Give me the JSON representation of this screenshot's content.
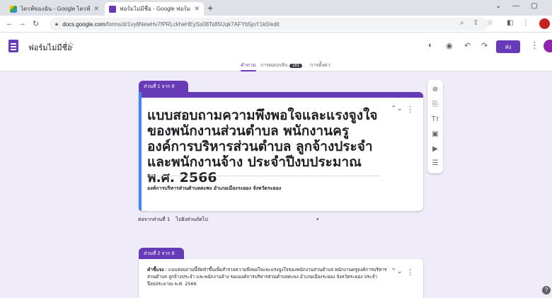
{
  "browser": {
    "tabs": [
      {
        "title": "ไดรฟ์ของฉัน - Google ไดรฟ์"
      },
      {
        "title": "ฟอร์มไม่มีชื่อ - Google ฟอร์ม"
      }
    ],
    "url_host": "docs.google.com",
    "url_path": "/forms/d/1vy8NewHv7fPRLckheHEySs08Ts85Uqk7AFYb5joY1k0/edit",
    "icons": [
      "back-icon",
      "forward-icon",
      "reload-icon",
      "lock-icon",
      "zoom-icon",
      "share-icon",
      "bookmark-star-icon",
      "sidepanel-icon",
      "profile-icon"
    ]
  },
  "form_header": {
    "title": "ฟอร์มไม่มีชื่อ",
    "send_label": "ส่ง",
    "tabs": [
      "คำถาม",
      "การตอบกลับ",
      "การตั้งค่า"
    ],
    "response_count": "181"
  },
  "section1": {
    "tag": "ส่วนที่ 1 จาก 8",
    "title": "แบบสอบถามความพึงพอใจและแรงจูงใจของพนักงานส่วนตำบล พนักงานครูองค์การบริหารส่วนตำบล ลูกจ้างประจำ และพนักงานจ้าง ประจำปีงบประมาณ พ.ศ. 2566",
    "subtitle": "องค์การบริหารส่วนตำบลตะพง อำเภอเมืองระยอง จังหวัดระยอง"
  },
  "after_section": {
    "label": "ต่อจากส่วนที่ 1",
    "value": "ไปยังส่วนถัดไป"
  },
  "section2": {
    "tag": "ส่วนที่ 2 จาก 8",
    "desc_label": "คำชี้แจง",
    "desc": ": แบบสอบถามนี้จัดทำขึ้นเพื่อสำรวจความพึงพอใจและแรงจูงใจของพนักงานส่วนตำบล พนักงานครูองค์การบริหารส่วนตำบล ลูกจ้างประจำ และพนักงานจ้าง ขององค์การบริหารส่วนตำบลตะพง อำเภอเมืองระยอง จังหวัดระยอง ประจำปีงบประมาณ พ.ศ. 2566"
  },
  "toolbar": [
    "add-question-icon",
    "import-questions-icon",
    "add-title-icon",
    "add-image-icon",
    "add-video-icon",
    "add-section-icon"
  ],
  "colors": {
    "accent": "#673ab7",
    "background": "#f0ebf8",
    "focus": "#4285f4"
  }
}
